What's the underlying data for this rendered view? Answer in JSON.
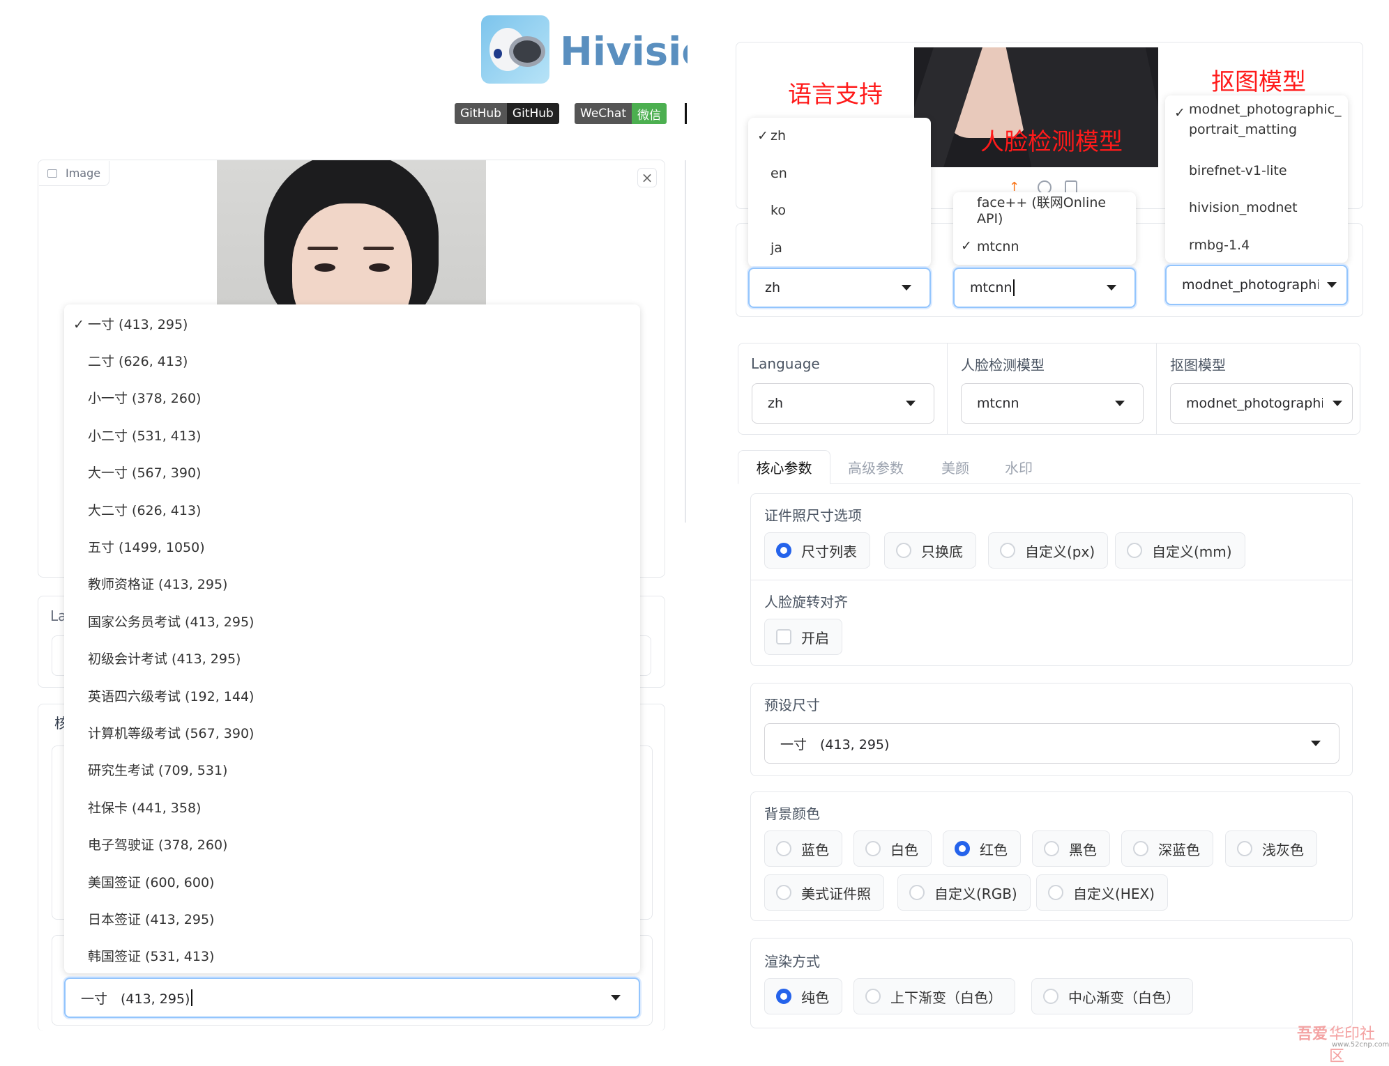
{
  "header": {
    "title": "Hivision",
    "github_badge_left": "GitHub",
    "github_badge_right": "GitHub",
    "wechat_badge_left": "WeChat",
    "wechat_badge_right": "微信"
  },
  "image_panel": {
    "label": "Image",
    "close": "×"
  },
  "size_dropdown": {
    "check": "✓",
    "options": [
      "一寸 (413, 295)",
      "二寸 (626, 413)",
      "小一寸 (378, 260)",
      "小二寸 (531, 413)",
      "大一寸 (567, 390)",
      "大二寸 (626, 413)",
      "五寸 (1499, 1050)",
      "教师资格证 (413, 295)",
      "国家公务员考试 (413, 295)",
      "初级会计考试 (413, 295)",
      "英语四六级考试 (192, 144)",
      "计算机等级考试 (567, 390)",
      "研究生考试 (709, 531)",
      "社保卡 (441, 358)",
      "电子驾驶证 (378, 260)",
      "美国签证 (600, 600)",
      "日本签证 (413, 295)",
      "韩国签证 (531, 413)"
    ],
    "value": "一寸　(413, 295)"
  },
  "left_truncated": {
    "la": "La",
    "he": "核"
  },
  "annotations": {
    "language": "语言支持",
    "face_model": "人脸检测模型",
    "matting_model": "抠图模型"
  },
  "language_menu": {
    "options": [
      "zh",
      "en",
      "ko",
      "ja"
    ],
    "check": "✓",
    "value": "zh"
  },
  "face_menu": {
    "options": [
      "face++ (联网Online API)",
      "mtcnn"
    ],
    "check": "✓",
    "value": "mtcnn"
  },
  "matting_menu": {
    "options": [
      "modnet_photographic_",
      "portrait_matting",
      "birefnet-v1-lite",
      "hivision_modnet",
      "rmbg-1.4"
    ],
    "check": "✓",
    "value": "modnet_photographic_portrait_matting"
  },
  "settings_row": {
    "language_label": "Language",
    "language_value": "zh",
    "face_label": "人脸检测模型",
    "face_value": "mtcnn",
    "matting_label": "抠图模型",
    "matting_value": "modnet_photographic_portrait_matting"
  },
  "tabs": [
    "核心参数",
    "高级参数",
    "美颜",
    "水印"
  ],
  "size_options": {
    "label": "证件照尺寸选项",
    "items": [
      "尺寸列表",
      "只换底",
      "自定义(px)",
      "自定义(mm)"
    ],
    "selected": 0
  },
  "face_align": {
    "label": "人脸旋转对齐",
    "item": "开启"
  },
  "preset": {
    "label": "预设尺寸",
    "value": "一寸　(413, 295)"
  },
  "bg_color": {
    "label": "背景颜色",
    "items": [
      "蓝色",
      "白色",
      "红色",
      "黑色",
      "深蓝色",
      "浅灰色",
      "美式证件照",
      "自定义(RGB)",
      "自定义(HEX)"
    ],
    "selected": 2
  },
  "render": {
    "label": "渲染方式",
    "items": [
      "纯色",
      "上下渐变（白色）",
      "中心渐变（白色）"
    ],
    "selected": 0
  },
  "watermark": {
    "logo": "吾爱",
    "text": "华印社区",
    "url": "www.52cnp.com"
  },
  "colors": {
    "accent": "#2563eb",
    "red": "#ff1a1a",
    "logo_text": "#5a8fbf"
  }
}
